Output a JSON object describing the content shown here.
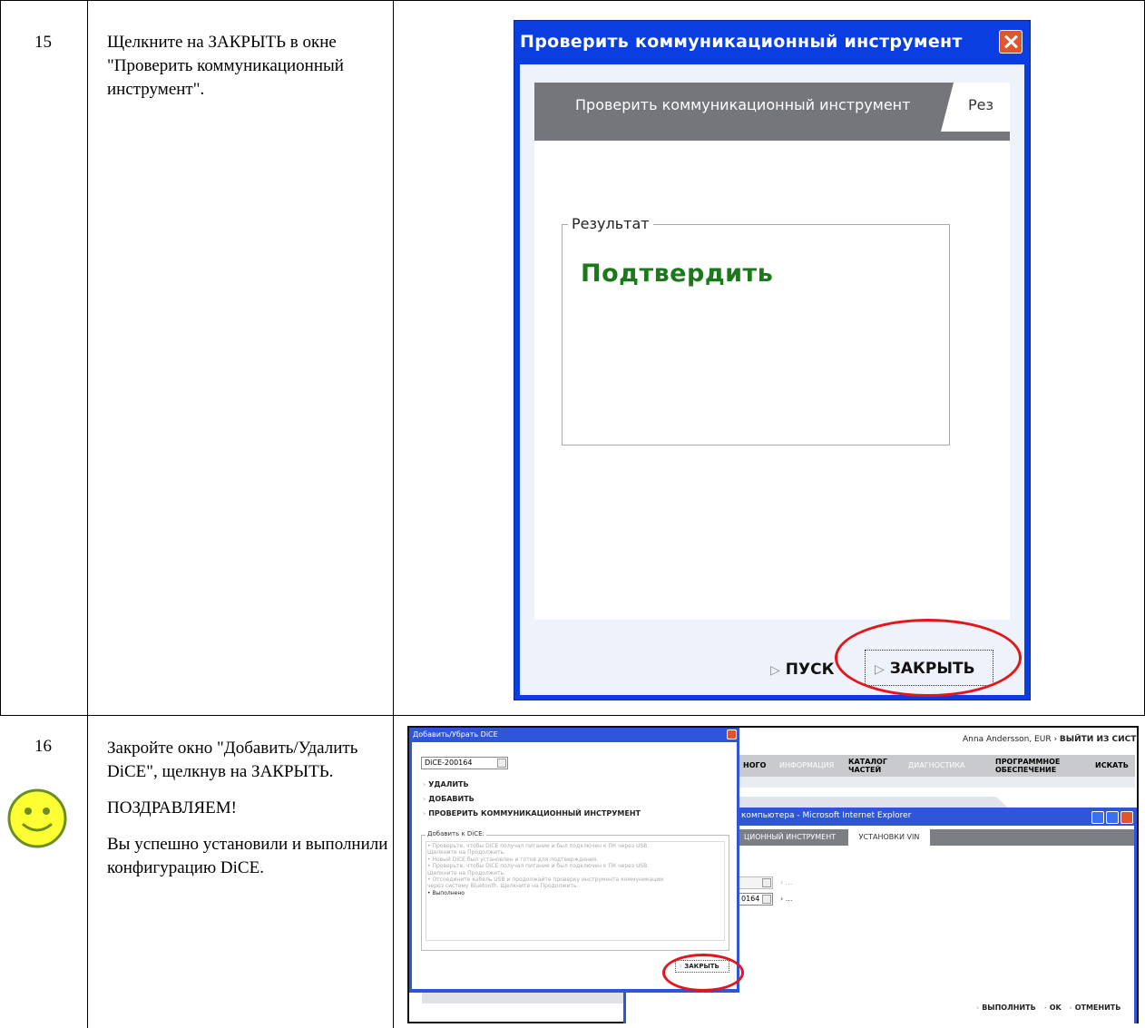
{
  "rows": [
    {
      "number": "15",
      "text": "Щелкните на ЗАКРЫТЬ в окне \"Проверить коммуникационный инструмент\"."
    },
    {
      "number": "16",
      "text": "Закройте окно \"Добавить/Удалить DiCE\", щелкнув на ЗАКРЫТЬ.",
      "congrats": "ПОЗДРАВЛЯЕМ!",
      "success": "Вы успешно установили и выполнили конфигурацию DiCE."
    }
  ],
  "dialog15": {
    "title": "Проверить коммуникационный инструмент",
    "tab_active": "Проверить коммуникационный инструмент",
    "tab_next": "Рез",
    "group_label": "Результат",
    "result": "Подтвердить",
    "start_button": "ПУСК",
    "close_button": "ЗАКРЫТЬ",
    "result_color": "#1a7a1a",
    "title_bar_color": "#0a3ee0",
    "highlight_color": "#e4161a"
  },
  "screenshot16": {
    "background": {
      "user": "Anna Andersson, EUR",
      "logout": "ВЫЙТИ ИЗ СИСТЕМЫ",
      "nav": [
        {
          "label": "НОГО"
        },
        {
          "label": "ИНФОРМАЦИЯ"
        },
        {
          "label": "КАТАЛОГ ЧАСТЕЙ"
        },
        {
          "label": "ДИАГНОСТИКА"
        },
        {
          "label": "ПРОГРАММНОЕ ОБЕСПЕЧЕНИЕ"
        },
        {
          "label": "ИСКАТЬ"
        }
      ],
      "ie_title": "компьютера - Microsoft Internet Explorer",
      "tab_partial": "ЦИОННЫЙ ИНСТРУМЕНТ",
      "tab_vin": "УСТАНОВКИ VIN",
      "select2_value": "0164",
      "dots": "...",
      "footer": [
        "ВЫПОЛНИТЬ",
        "OK",
        "ОТМЕНИТЬ"
      ]
    },
    "dialog": {
      "title": "Добавить/Убрать DiCE",
      "select_value": "DiCE-200164",
      "links": [
        "УДАЛИТЬ",
        "ДОБАВИТЬ",
        "ПРОВЕРИТЬ КОММУНИКАЦИОННЫЙ ИНСТРУМЕНТ"
      ],
      "group_label": "Добавить к DiCE:",
      "log": [
        "• Проверьте, чтобы DiCE получал питание и был подключен к ПК через USB. Щелкните на Продолжить.",
        "• Новый DiCE был установлен и готов для подтверждения.",
        "• Проверьте, чтобы DiCE получал питание и был подключен к ПК через USB. Щелкните на Продолжить.",
        "• Отсоедините кабель USB и продолжайте проверку инструмента коммуникации через систему Bluetooth. Щелкните на Продолжить."
      ],
      "log_done": "• Выполнено",
      "close_button": "ЗАКРЫТЬ"
    }
  },
  "smiley_icon": "smiley-face-icon"
}
